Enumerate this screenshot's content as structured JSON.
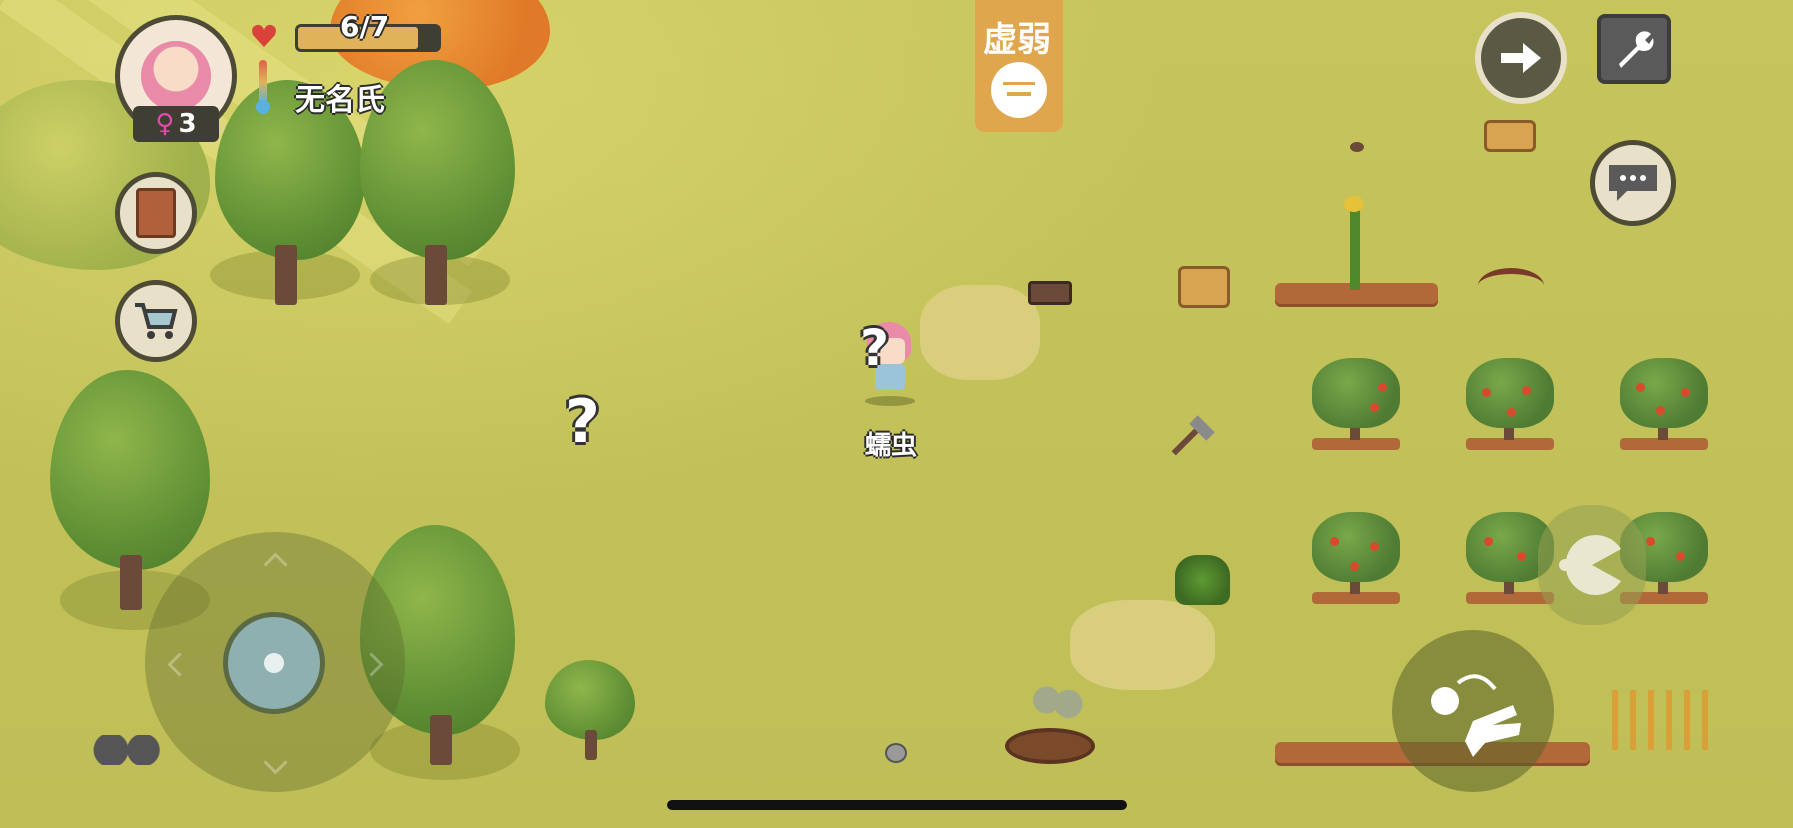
{
  "hud": {
    "health_text": "6/7",
    "health_fraction": 0.86,
    "player_name": "无名氏",
    "gender_symbol": "♀",
    "level": "3",
    "status_label": "虚弱"
  },
  "world": {
    "npc_label": "蠕虫",
    "question_mark": "?"
  },
  "colors": {
    "grass": "#c4c35a",
    "health_fill": "#e0b25a",
    "status_bg": "#e0a64e",
    "heart": "#d8423a",
    "ui_dark": "#4d4a35"
  },
  "icons": {
    "heart": "heart-icon",
    "thermometer": "thermometer-icon",
    "exit": "arrow-right-icon",
    "settings": "wrench-icon",
    "chat": "speech-bubble-icon",
    "book": "book-icon",
    "shop": "shopping-cart-icon",
    "pacman": "eat-icon",
    "interact": "grab-hand-icon"
  }
}
